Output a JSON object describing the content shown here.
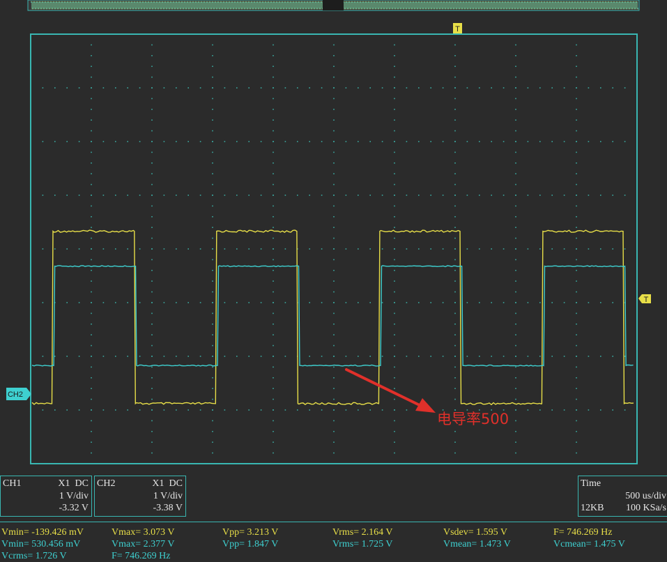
{
  "markers": {
    "trigger_position": "T",
    "trigger_level": "T",
    "ch2_ref": "CH2"
  },
  "annotation": {
    "text": "电导率500",
    "color": "#e0302a"
  },
  "colors": {
    "ch1_trace": "#e8df48",
    "ch2_trace": "#3ed0d0",
    "frame": "#39b7b2",
    "background": "#2b2b2b",
    "grid_dots": "#3aa8a0"
  },
  "grid": {
    "divisions_x": 10,
    "divisions_y": 8
  },
  "channels": [
    {
      "name": "CH1",
      "probe": "X1",
      "coupling": "DC",
      "scale": "1 V/div",
      "offset": "-3.32 V"
    },
    {
      "name": "CH2",
      "probe": "X1",
      "coupling": "DC",
      "scale": "1 V/div",
      "offset": "-3.38 V"
    }
  ],
  "timebase": {
    "label": "Time",
    "scale": "500 us/div",
    "memory": "12KB",
    "rate": "100 KSa/s"
  },
  "measurements": {
    "row1": [
      "Vmin= -139.426 mV",
      "Vmax= 3.073 V",
      "Vpp= 3.213 V",
      "Vrms= 2.164 V",
      "Vsdev= 1.595 V",
      "F= 746.269 Hz"
    ],
    "row2": [
      "Vmin= 530.456 mV",
      "Vmax= 2.377 V",
      "Vpp= 1.847 V",
      "Vrms= 1.725 V",
      "Vmean= 1.473 V",
      "Vcmean= 1.475 V"
    ],
    "row3": [
      "Vcrms= 1.726 V",
      "F= 746.269 Hz"
    ]
  },
  "chart_data": {
    "type": "line",
    "x_unit": "div",
    "y_unit": "V",
    "series": [
      {
        "name": "CH1",
        "color": "#e8df48",
        "low_v": -0.14,
        "high_v": 3.07,
        "edges": [
          {
            "x": 0.35,
            "rise": true
          },
          {
            "x": 1.71,
            "rise": false
          },
          {
            "x": 3.05,
            "rise": true
          },
          {
            "x": 4.39,
            "rise": false
          },
          {
            "x": 5.74,
            "rise": true
          },
          {
            "x": 7.08,
            "rise": false
          },
          {
            "x": 8.43,
            "rise": true
          },
          {
            "x": 9.77,
            "rise": false
          }
        ]
      },
      {
        "name": "CH2",
        "color": "#3ed0d0",
        "low_v": 0.53,
        "high_v": 2.38,
        "edges": [
          {
            "x": 0.38,
            "rise": true
          },
          {
            "x": 1.73,
            "rise": false
          },
          {
            "x": 3.08,
            "rise": true
          },
          {
            "x": 4.42,
            "rise": false
          },
          {
            "x": 5.77,
            "rise": true
          },
          {
            "x": 7.11,
            "rise": false
          },
          {
            "x": 8.46,
            "rise": true
          },
          {
            "x": 9.8,
            "rise": false
          }
        ]
      }
    ]
  }
}
